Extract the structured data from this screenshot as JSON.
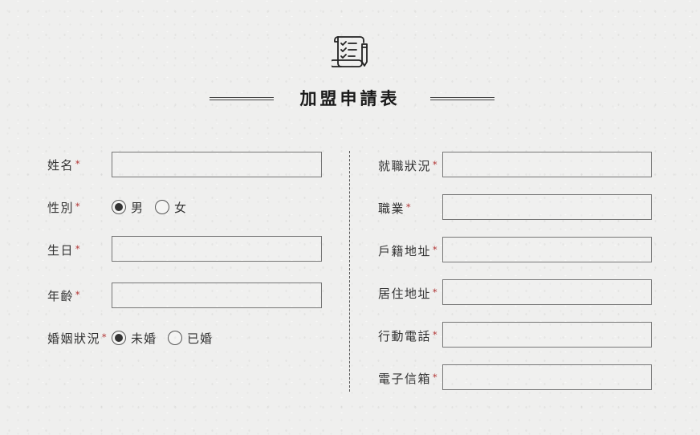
{
  "header": {
    "icon": "checklist-scroll-icon",
    "title": "加盟申請表"
  },
  "left": {
    "name_label": "姓名",
    "gender_label": "性別",
    "gender_options": [
      "男",
      "女"
    ],
    "gender_selected": "男",
    "birthday_label": "生日",
    "age_label": "年齡",
    "marital_label": "婚姻狀況",
    "marital_options": [
      "未婚",
      "已婚"
    ],
    "marital_selected": "未婚"
  },
  "right": {
    "employment_label": "就職狀況",
    "occupation_label": "職業",
    "registered_address_label": "戶籍地址",
    "residential_address_label": "居住地址",
    "mobile_label": "行動電話",
    "email_label": "電子信箱"
  },
  "required_mark": "*",
  "colors": {
    "required": "#b03030",
    "border": "#777777",
    "text": "#333333"
  }
}
